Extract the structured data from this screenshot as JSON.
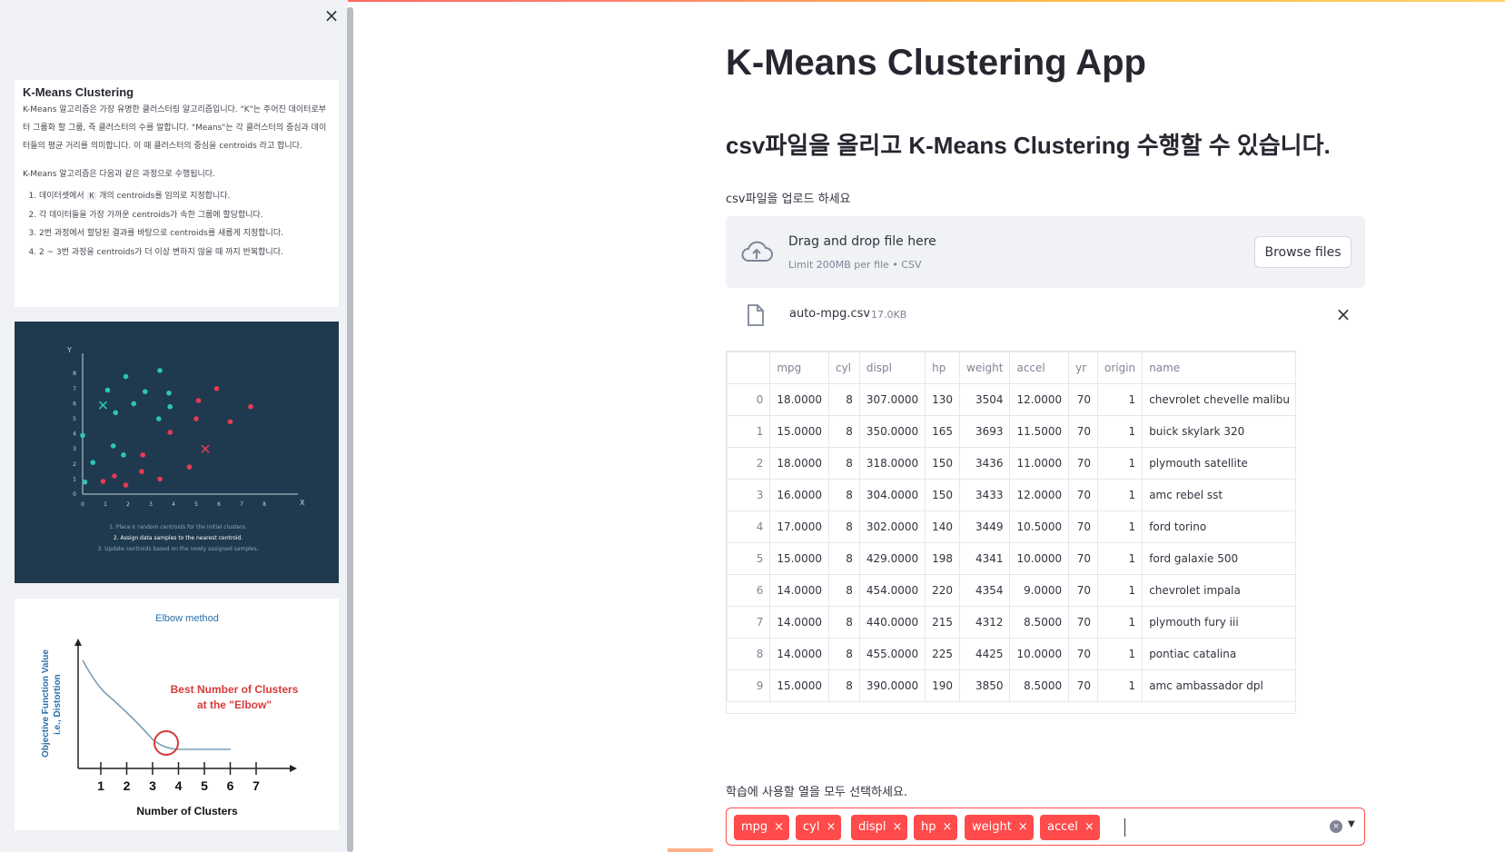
{
  "sidebar": {
    "info": {
      "title": "K-Means Clustering",
      "para1": "K-Means 알고리즘은 가장 유명한 클러스터링 알고리즘입니다. \"K\"는 주어진 데이터로부터 그룹화 할 그룹, 즉 클러스터의 수를 말합니다. \"Means\"는 각 클러스터의 중심과 데이터들의 평균 거리를 의미합니다. 이 때 클러스터의 중심을 centroids 라고 합니다.",
      "para2": "K-Means 알고리즘은 다음과 같은 과정으로 수행됩니다.",
      "step1_pre": "데이터셋에서",
      "step1_code": "K",
      "step1_post": "개의 centroids를 임의로 지정합니다.",
      "step2": "각 데이터들을 가장 가까운 centroids가 속한 그룹에 할당합니다.",
      "step3": "2번 과정에서 할당된 결과를 바탕으로 centroids를 새롭게 지정합니다.",
      "step4": "2 ~ 3번 과정을 centroids가 더 이상 변하지 않을 때 까지 반복합니다."
    },
    "scatter_image": {
      "y_axis": "Y",
      "x_axis": "X",
      "x_ticks": [
        "0",
        "1",
        "2",
        "3",
        "4",
        "5",
        "6",
        "7",
        "8"
      ],
      "y_ticks": [
        "0",
        "1",
        "2",
        "3",
        "4",
        "5",
        "6",
        "7",
        "8"
      ],
      "caption1": "1. Place k random centroids for the initial clusters.",
      "caption2": "2. Assign data samples to the nearest centroid.",
      "caption3": "3. Update centroids based on the newly assigned samples.",
      "colors": {
        "bg": "#1f3a4f",
        "teal": "#2ec4b6",
        "red": "#e63b55"
      }
    },
    "elbow_image": {
      "title": "Elbow method",
      "y_label1": "Objective Function Value",
      "y_label2": "i.e., Distortion",
      "annotation1": "Best Number of Clusters",
      "annotation2": "at the \"Elbow\"",
      "x_label": "Number of Clusters",
      "x_ticks": [
        "1",
        "2",
        "3",
        "4",
        "5",
        "6",
        "7"
      ]
    }
  },
  "main": {
    "title": "K-Means Clustering App",
    "subtitle": "csv파일을 올리고 K-Means Clustering 수행할 수 있습니다.",
    "uploader": {
      "label": "csv파일을 업로드 하세요",
      "drag_text": "Drag and drop file here",
      "limit_text": "Limit 200MB per file • CSV",
      "browse_label": "Browse files"
    },
    "file": {
      "name": "auto-mpg.csv",
      "size": "17.0KB"
    },
    "table": {
      "columns": [
        "",
        "mpg",
        "cyl",
        "displ",
        "hp",
        "weight",
        "accel",
        "yr",
        "origin",
        "name"
      ],
      "rows": [
        [
          "0",
          "18.0000",
          "8",
          "307.0000",
          "130",
          "3504",
          "12.0000",
          "70",
          "1",
          "chevrolet chevelle malibu"
        ],
        [
          "1",
          "15.0000",
          "8",
          "350.0000",
          "165",
          "3693",
          "11.5000",
          "70",
          "1",
          "buick skylark 320"
        ],
        [
          "2",
          "18.0000",
          "8",
          "318.0000",
          "150",
          "3436",
          "11.0000",
          "70",
          "1",
          "plymouth satellite"
        ],
        [
          "3",
          "16.0000",
          "8",
          "304.0000",
          "150",
          "3433",
          "12.0000",
          "70",
          "1",
          "amc rebel sst"
        ],
        [
          "4",
          "17.0000",
          "8",
          "302.0000",
          "140",
          "3449",
          "10.5000",
          "70",
          "1",
          "ford torino"
        ],
        [
          "5",
          "15.0000",
          "8",
          "429.0000",
          "198",
          "4341",
          "10.0000",
          "70",
          "1",
          "ford galaxie 500"
        ],
        [
          "6",
          "14.0000",
          "8",
          "454.0000",
          "220",
          "4354",
          "9.0000",
          "70",
          "1",
          "chevrolet impala"
        ],
        [
          "7",
          "14.0000",
          "8",
          "440.0000",
          "215",
          "4312",
          "8.5000",
          "70",
          "1",
          "plymouth fury iii"
        ],
        [
          "8",
          "14.0000",
          "8",
          "455.0000",
          "225",
          "4425",
          "10.0000",
          "70",
          "1",
          "pontiac catalina"
        ],
        [
          "9",
          "15.0000",
          "8",
          "390.0000",
          "190",
          "3850",
          "8.5000",
          "70",
          "1",
          "amc ambassador dpl"
        ]
      ]
    },
    "multiselect": {
      "label": "학습에 사용할 열을 모두 선택하세요.",
      "selected": [
        "mpg",
        "cyl",
        "displ",
        "hp",
        "weight",
        "accel"
      ],
      "tag_remove_glyph": "×",
      "clear_glyph": "×",
      "dropdown_glyph": "▼"
    },
    "colors": {
      "accent": "#ff4b4b",
      "widget_bg": "#f0f2f6",
      "text": "#262730"
    }
  },
  "icons": {
    "sidebar_close": "×",
    "file_remove": "×"
  }
}
